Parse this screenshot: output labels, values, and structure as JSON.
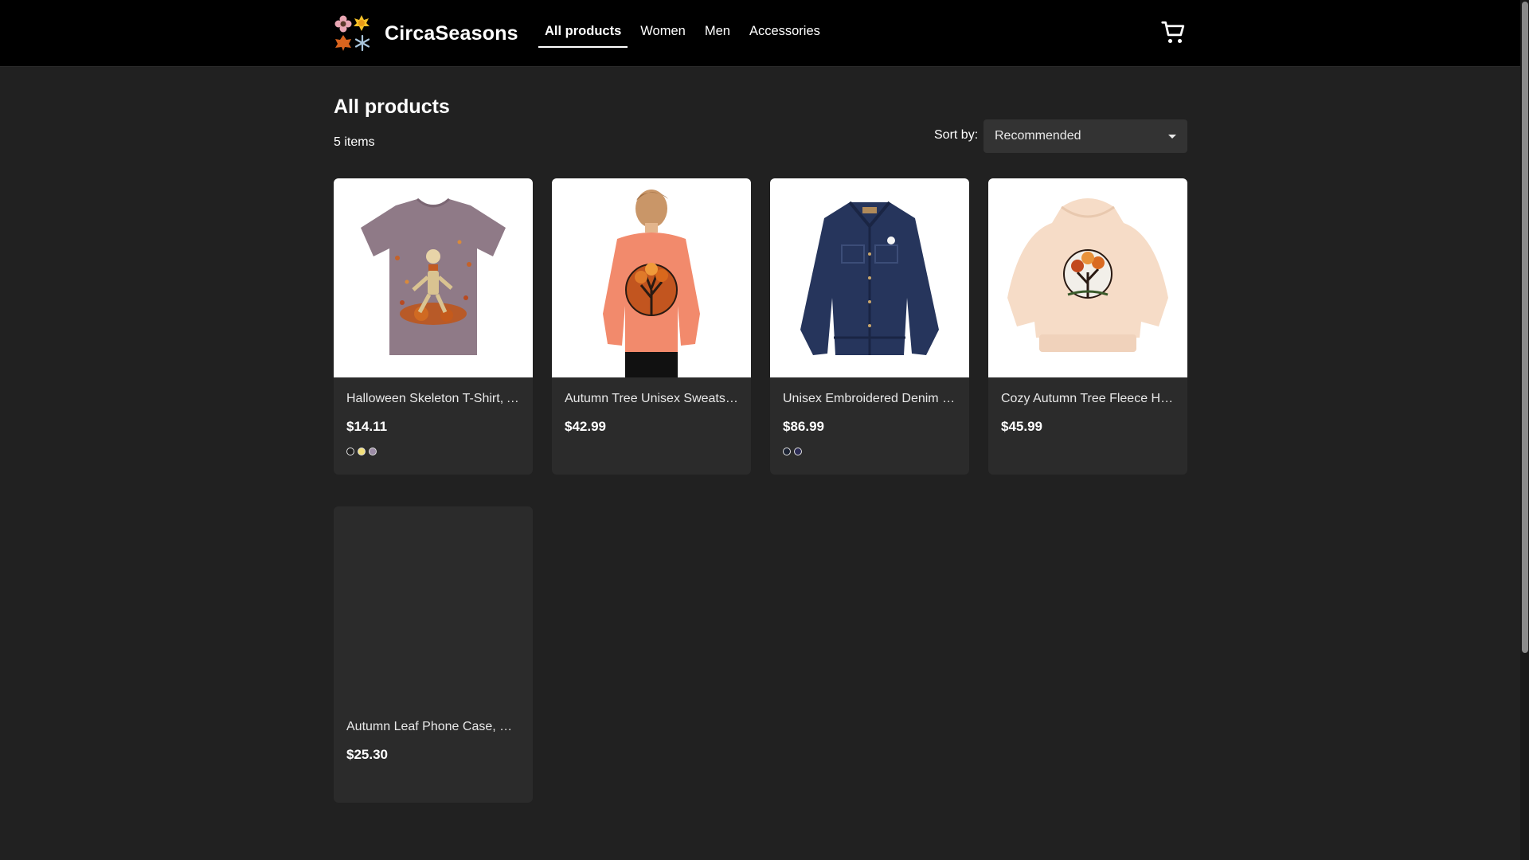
{
  "header": {
    "brand_name": "CircaSeasons",
    "nav": [
      {
        "label": "All products",
        "active": true
      },
      {
        "label": "Women",
        "active": false
      },
      {
        "label": "Men",
        "active": false
      },
      {
        "label": "Accessories",
        "active": false
      }
    ],
    "cart_icon": "shopping-cart-icon"
  },
  "main": {
    "title": "All products",
    "item_count": "5 items",
    "sort": {
      "label": "Sort by:",
      "selected": "Recommended"
    },
    "products": [
      {
        "title": "Halloween Skeleton T-Shirt, A...",
        "price": "$14.11",
        "swatches": [
          "#1f1f1f",
          "#f3e07a",
          "#9c8ca6"
        ]
      },
      {
        "title": "Autumn Tree Unisex Sweatsh...",
        "price": "$42.99",
        "swatches": []
      },
      {
        "title": "Unisex Embroidered Denim J...",
        "price": "$86.99",
        "swatches": [
          "#1c2333",
          "#2c2c55"
        ]
      },
      {
        "title": "Cozy Autumn Tree Fleece Ho...",
        "price": "$45.99",
        "swatches": []
      },
      {
        "title": "Autumn Leaf Phone Case, M...",
        "price": "$25.30",
        "swatches": []
      }
    ]
  },
  "colors": {
    "background": "#212121",
    "header": "#000000",
    "card": "#2b2b2b",
    "select": "#333333"
  }
}
